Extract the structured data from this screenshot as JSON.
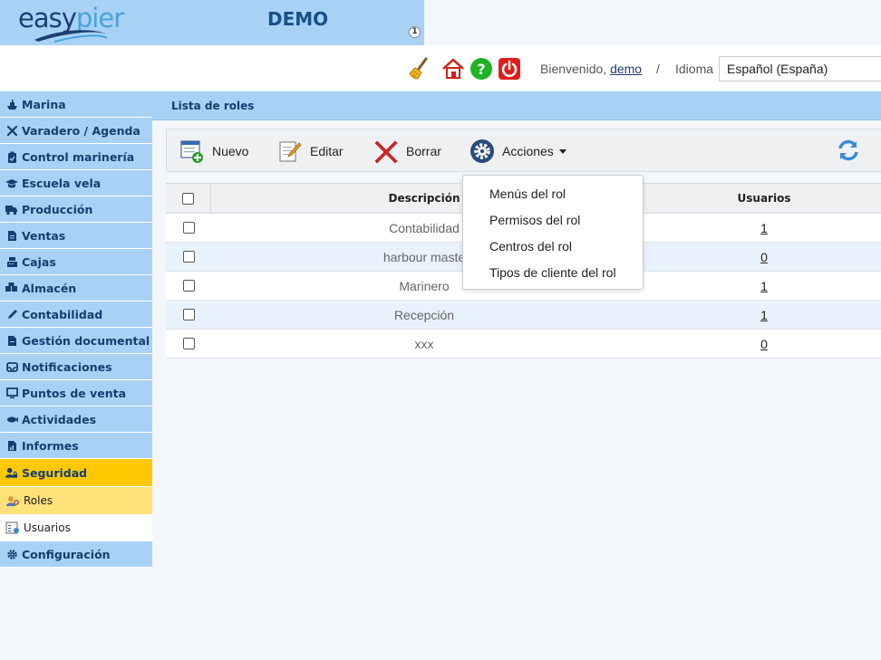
{
  "header": {
    "logo_part1": "easy",
    "logo_part2": "pier",
    "company": "DEMO",
    "notification_count": "1"
  },
  "topbar": {
    "icons": [
      "broom-icon",
      "home-icon",
      "help-icon",
      "power-icon"
    ],
    "welcome_text": "Bienvenido,",
    "username": "demo",
    "separator": "/",
    "language_label": "Idioma",
    "language_value": "Español (España)"
  },
  "sidebar": {
    "items": [
      {
        "label": "Marina",
        "icon": "ship-icon"
      },
      {
        "label": "Varadero / Agenda",
        "icon": "tools-icon"
      },
      {
        "label": "Control marinería",
        "icon": "clipboard-icon"
      },
      {
        "label": "Escuela vela",
        "icon": "graduation-cap-icon"
      },
      {
        "label": "Producción",
        "icon": "truck-icon"
      },
      {
        "label": "Ventas",
        "icon": "document-icon"
      },
      {
        "label": "Cajas",
        "icon": "cash-register-icon"
      },
      {
        "label": "Almacén",
        "icon": "boxes-icon"
      },
      {
        "label": "Contabilidad",
        "icon": "pencil-icon"
      },
      {
        "label": "Gestión documental",
        "icon": "file-icon"
      },
      {
        "label": "Notificaciones",
        "icon": "inbox-icon"
      },
      {
        "label": "Puntos de venta",
        "icon": "monitor-icon"
      },
      {
        "label": "Actividades",
        "icon": "fish-icon"
      },
      {
        "label": "Informes",
        "icon": "report-icon"
      }
    ],
    "active": {
      "label": "Seguridad",
      "icon": "user-lock-icon"
    },
    "subitems": [
      {
        "label": "Roles",
        "icon": "roles-icon"
      },
      {
        "label": "Usuarios",
        "icon": "users-icon"
      }
    ],
    "after": {
      "label": "Configuración",
      "icon": "gear-icon"
    }
  },
  "page": {
    "title": "Lista de roles"
  },
  "actions": {
    "new_label": "Nuevo",
    "edit_label": "Editar",
    "delete_label": "Borrar",
    "actions_label": "Acciones"
  },
  "dropdown": {
    "items": [
      "Menús del rol",
      "Permisos del rol",
      "Centros del rol",
      "Tipos de cliente del rol"
    ]
  },
  "table": {
    "headers": {
      "description": "Descripción",
      "users": "Usuarios"
    },
    "rows": [
      {
        "description": "Contabilidad",
        "users": "1"
      },
      {
        "description": "harbour maste",
        "users": "0"
      },
      {
        "description": "Marinero",
        "users": "1"
      },
      {
        "description": "Recepción",
        "users": "1"
      },
      {
        "description": "xxx",
        "users": "0"
      }
    ]
  },
  "colors": {
    "header_blue": "#a8d2f5",
    "nav_text": "#153e70",
    "active_yellow": "#ffc800",
    "sub_selected": "#ffe27a"
  }
}
